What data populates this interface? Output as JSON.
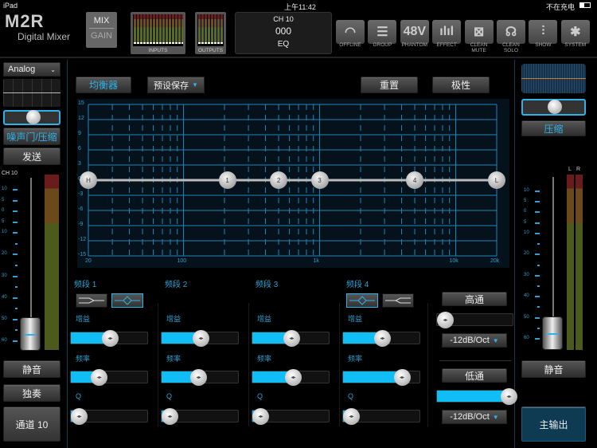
{
  "status_bar": {
    "device": "iPad",
    "time": "上午11:42",
    "charging": "不在充电"
  },
  "header": {
    "logo": "M2R",
    "logo_sub": "Digital Mixer",
    "mix": "MIX",
    "gain": "GAIN",
    "inputs": "INPUTS",
    "outputs": "OUTPUTS",
    "display": {
      "channel": "CH 10",
      "value": "000",
      "mode": "EQ"
    },
    "icons": [
      {
        "icon": "wifi-icon",
        "label": "OFFLINE"
      },
      {
        "icon": "group-icon",
        "label": "GROUP"
      },
      {
        "icon": "48v-icon",
        "glyph": "48V",
        "label": "PHANTOM"
      },
      {
        "icon": "effect-icon",
        "label": "EFFECT"
      },
      {
        "icon": "clean-mute-icon",
        "label": "CLEAN MUTE"
      },
      {
        "icon": "clean-solo-icon",
        "label": "CLEAN SOLO"
      },
      {
        "icon": "show-icon",
        "label": "SHOW"
      },
      {
        "icon": "gear-icon",
        "label": "SYSTEM"
      }
    ]
  },
  "left": {
    "source": "Analog",
    "gate": "噪声门/压缩",
    "send": "发送",
    "channel": "CH 10",
    "mute": "静音",
    "solo": "独奏",
    "channel_btn": "通道 10",
    "fader": 0.05,
    "scale": [
      "10",
      "5",
      "0",
      "5",
      "10",
      "",
      "20",
      "",
      "30",
      "",
      "40",
      "",
      "50",
      "",
      "60"
    ]
  },
  "toolbar": {
    "eq": "均衡器",
    "preset": "预设保存",
    "reset": "重置",
    "polarity": "极性"
  },
  "eq_graph": {
    "y_ticks": [
      "15",
      "12",
      "9",
      "6",
      "3",
      "0",
      "-3",
      "-6",
      "-9",
      "-12",
      "-15"
    ],
    "x_ticks": [
      {
        "f": 20,
        "label": "20"
      },
      {
        "f": 100,
        "label": "100"
      },
      {
        "f": 1000,
        "label": "1k"
      },
      {
        "f": 10000,
        "label": "10k"
      },
      {
        "f": 20000,
        "label": "20k"
      }
    ],
    "nodes": [
      {
        "label": "H",
        "freq": 20,
        "gain": 0
      },
      {
        "label": "1",
        "freq": 210,
        "gain": 0
      },
      {
        "label": "2",
        "freq": 500,
        "gain": 0
      },
      {
        "label": "3",
        "freq": 1000,
        "gain": 0
      },
      {
        "label": "4",
        "freq": 5000,
        "gain": 0
      },
      {
        "label": "L",
        "freq": 20000,
        "gain": 0
      }
    ]
  },
  "bands": [
    {
      "title": "频段 1",
      "gain_label": "增益",
      "freq_label": "频率",
      "q_label": "Q",
      "gain": 0.5,
      "freq": 0.36,
      "q": 0.05
    },
    {
      "title": "频段 2",
      "gain_label": "增益",
      "freq_label": "频率",
      "q_label": "Q",
      "gain": 0.5,
      "freq": 0.47,
      "q": 0.05
    },
    {
      "title": "频段 3",
      "gain_label": "增益",
      "freq_label": "频率",
      "q_label": "Q",
      "gain": 0.5,
      "freq": 0.52,
      "q": 0.05
    },
    {
      "title": "频段 4",
      "gain_label": "增益",
      "freq_label": "频率",
      "q_label": "Q",
      "gain": 0.5,
      "freq": 0.75,
      "q": 0.05
    }
  ],
  "filters": {
    "highpass": "高通",
    "highpass_value": 0,
    "highpass_slope": "-12dB/Oct",
    "lowpass": "低通",
    "lowpass_value": 1,
    "lowpass_slope": "-12dB/Oct"
  },
  "right": {
    "comp": "压缩",
    "l": "L",
    "r": "R",
    "mute": "静音",
    "main": "主输出",
    "fader": 0.05
  }
}
